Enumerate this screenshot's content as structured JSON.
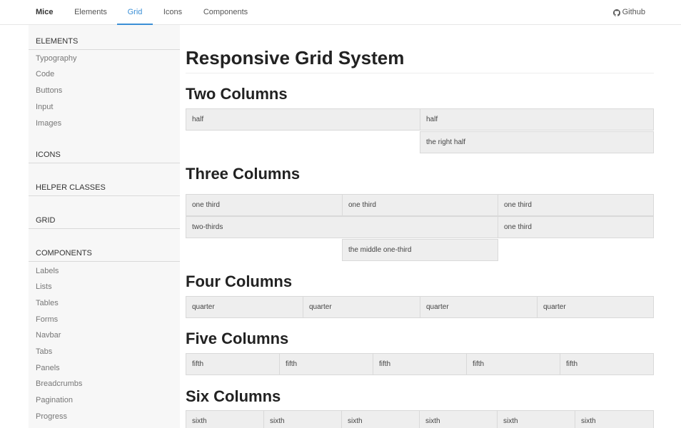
{
  "nav": {
    "brand": "Mice",
    "items": [
      "Elements",
      "Grid",
      "Icons",
      "Components"
    ],
    "active": "Grid",
    "github": "Github"
  },
  "sidebar": {
    "sections": [
      {
        "title": "ELEMENTS",
        "items": [
          "Typography",
          "Code",
          "Buttons",
          "Input",
          "Images"
        ]
      },
      {
        "title": "ICONS",
        "items": []
      },
      {
        "title": "HELPER CLASSES",
        "items": []
      },
      {
        "title": "GRID",
        "items": []
      },
      {
        "title": "COMPONENTS",
        "items": [
          "Labels",
          "Lists",
          "Tables",
          "Forms",
          "Navbar",
          "Tabs",
          "Panels",
          "Breadcrumbs",
          "Pagination",
          "Progress"
        ]
      }
    ]
  },
  "main": {
    "title": "Responsive Grid System",
    "sections": [
      {
        "title": "Two Columns",
        "rows": [
          [
            "half",
            "half"
          ],
          [
            "the right half"
          ]
        ]
      },
      {
        "title": "Three Columns",
        "rows": [
          [
            "one third",
            "one third",
            "one third"
          ],
          [
            "two-thirds",
            "one third"
          ],
          [
            "the middle one-third"
          ]
        ]
      },
      {
        "title": "Four Columns",
        "rows": [
          [
            "quarter",
            "quarter",
            "quarter",
            "quarter"
          ]
        ]
      },
      {
        "title": "Five Columns",
        "rows": [
          [
            "fifth",
            "fifth",
            "fifth",
            "fifth",
            "fifth"
          ]
        ]
      },
      {
        "title": "Six Columns",
        "rows": [
          [
            "sixth",
            "sixth",
            "sixth",
            "sixth",
            "sixth",
            "sixth"
          ]
        ]
      }
    ]
  }
}
